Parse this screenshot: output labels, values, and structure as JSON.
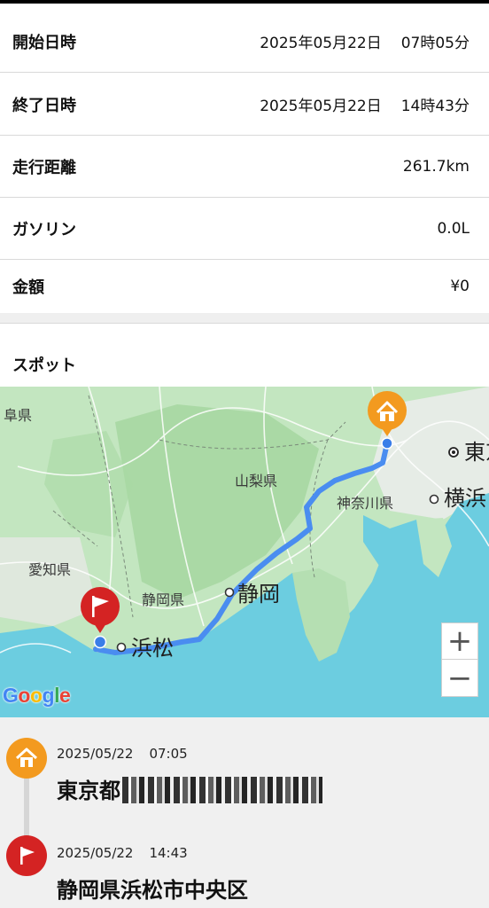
{
  "details": {
    "start": {
      "label": "開始日時",
      "date": "2025年05月22日",
      "time": "07時05分"
    },
    "end": {
      "label": "終了日時",
      "date": "2025年05月22日",
      "time": "14時43分"
    },
    "distance": {
      "label": "走行距離",
      "value": "261.7km"
    },
    "gasoline": {
      "label": "ガソリン",
      "value": "0.0L"
    },
    "amount": {
      "label": "金額",
      "value": "¥0"
    }
  },
  "spot": {
    "title": "スポット"
  },
  "map": {
    "labels": {
      "gifu": "阜県",
      "yamanashi": "山梨県",
      "kanagawa": "神奈川県",
      "aichi": "愛知県",
      "shizuoka_pref": "静岡県",
      "shizuoka": "静岡",
      "hamamatsu": "浜松",
      "tokyo": "東京",
      "yokohama": "横浜"
    },
    "zoom_in": "+",
    "zoom_out": "−",
    "attribution": [
      "G",
      "o",
      "o",
      "g",
      "l",
      "e"
    ],
    "route_color": "#4a8df0",
    "start_marker_color": "#f39a1f",
    "goal_marker_color": "#d42323"
  },
  "timeline": [
    {
      "date": "2025/05/22",
      "time": "07:05",
      "place": "東京都",
      "icon": "home-icon"
    },
    {
      "date": "2025/05/22",
      "time": "14:43",
      "place": "静岡県浜松市中央区",
      "icon": "flag-icon"
    }
  ]
}
